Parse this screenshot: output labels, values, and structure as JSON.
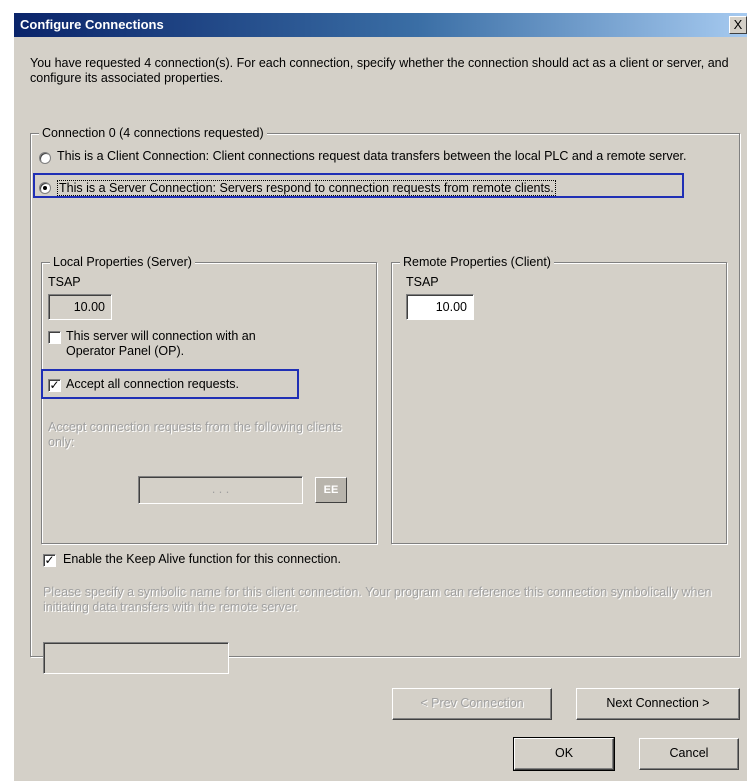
{
  "window": {
    "title": "Configure Connections",
    "close_label": "X"
  },
  "intro_text": "You have requested 4 connection(s).  For each connection, specify whether the connection should act as a client or server, and configure its associated properties.",
  "connection_group": {
    "label": "Connection 0 (4 connections requested)",
    "client_radio_label": "This is a Client Connection: Client connections request data transfers between the local PLC and a remote server.",
    "server_radio_label": "This is a Server Connection: Servers respond to connection requests from remote clients.",
    "selected": "server"
  },
  "local_properties": {
    "label": "Local Properties (Server)",
    "tsap_label": "TSAP",
    "tsap_value": "10.00",
    "op_checkbox_label": "This server will connection with an Operator Panel (OP).",
    "op_checked": false,
    "accept_all_label": "Accept all connection requests.",
    "accept_all_checked": true,
    "accept_from_label": "Accept connection requests from the following clients only:",
    "ip_placeholder": ". . .",
    "ip_button_label": "EE"
  },
  "remote_properties": {
    "label": "Remote Properties (Client)",
    "tsap_label": "TSAP",
    "tsap_value": "10.00"
  },
  "keep_alive": {
    "label": "Enable the Keep Alive function for this connection.",
    "checked": true
  },
  "symbolic_name": {
    "instruction": "Please specify a symbolic name for this client connection.  Your program can reference this connection symbolically when initiating data transfers with the remote server.",
    "value": ""
  },
  "buttons": {
    "prev": "< Prev Connection",
    "next": "Next Connection >",
    "ok": "OK",
    "cancel": "Cancel"
  },
  "colors": {
    "highlight": "#1f2fb5",
    "title_bar": "#0a246a",
    "dialog_bg": "#d4d0c8"
  }
}
